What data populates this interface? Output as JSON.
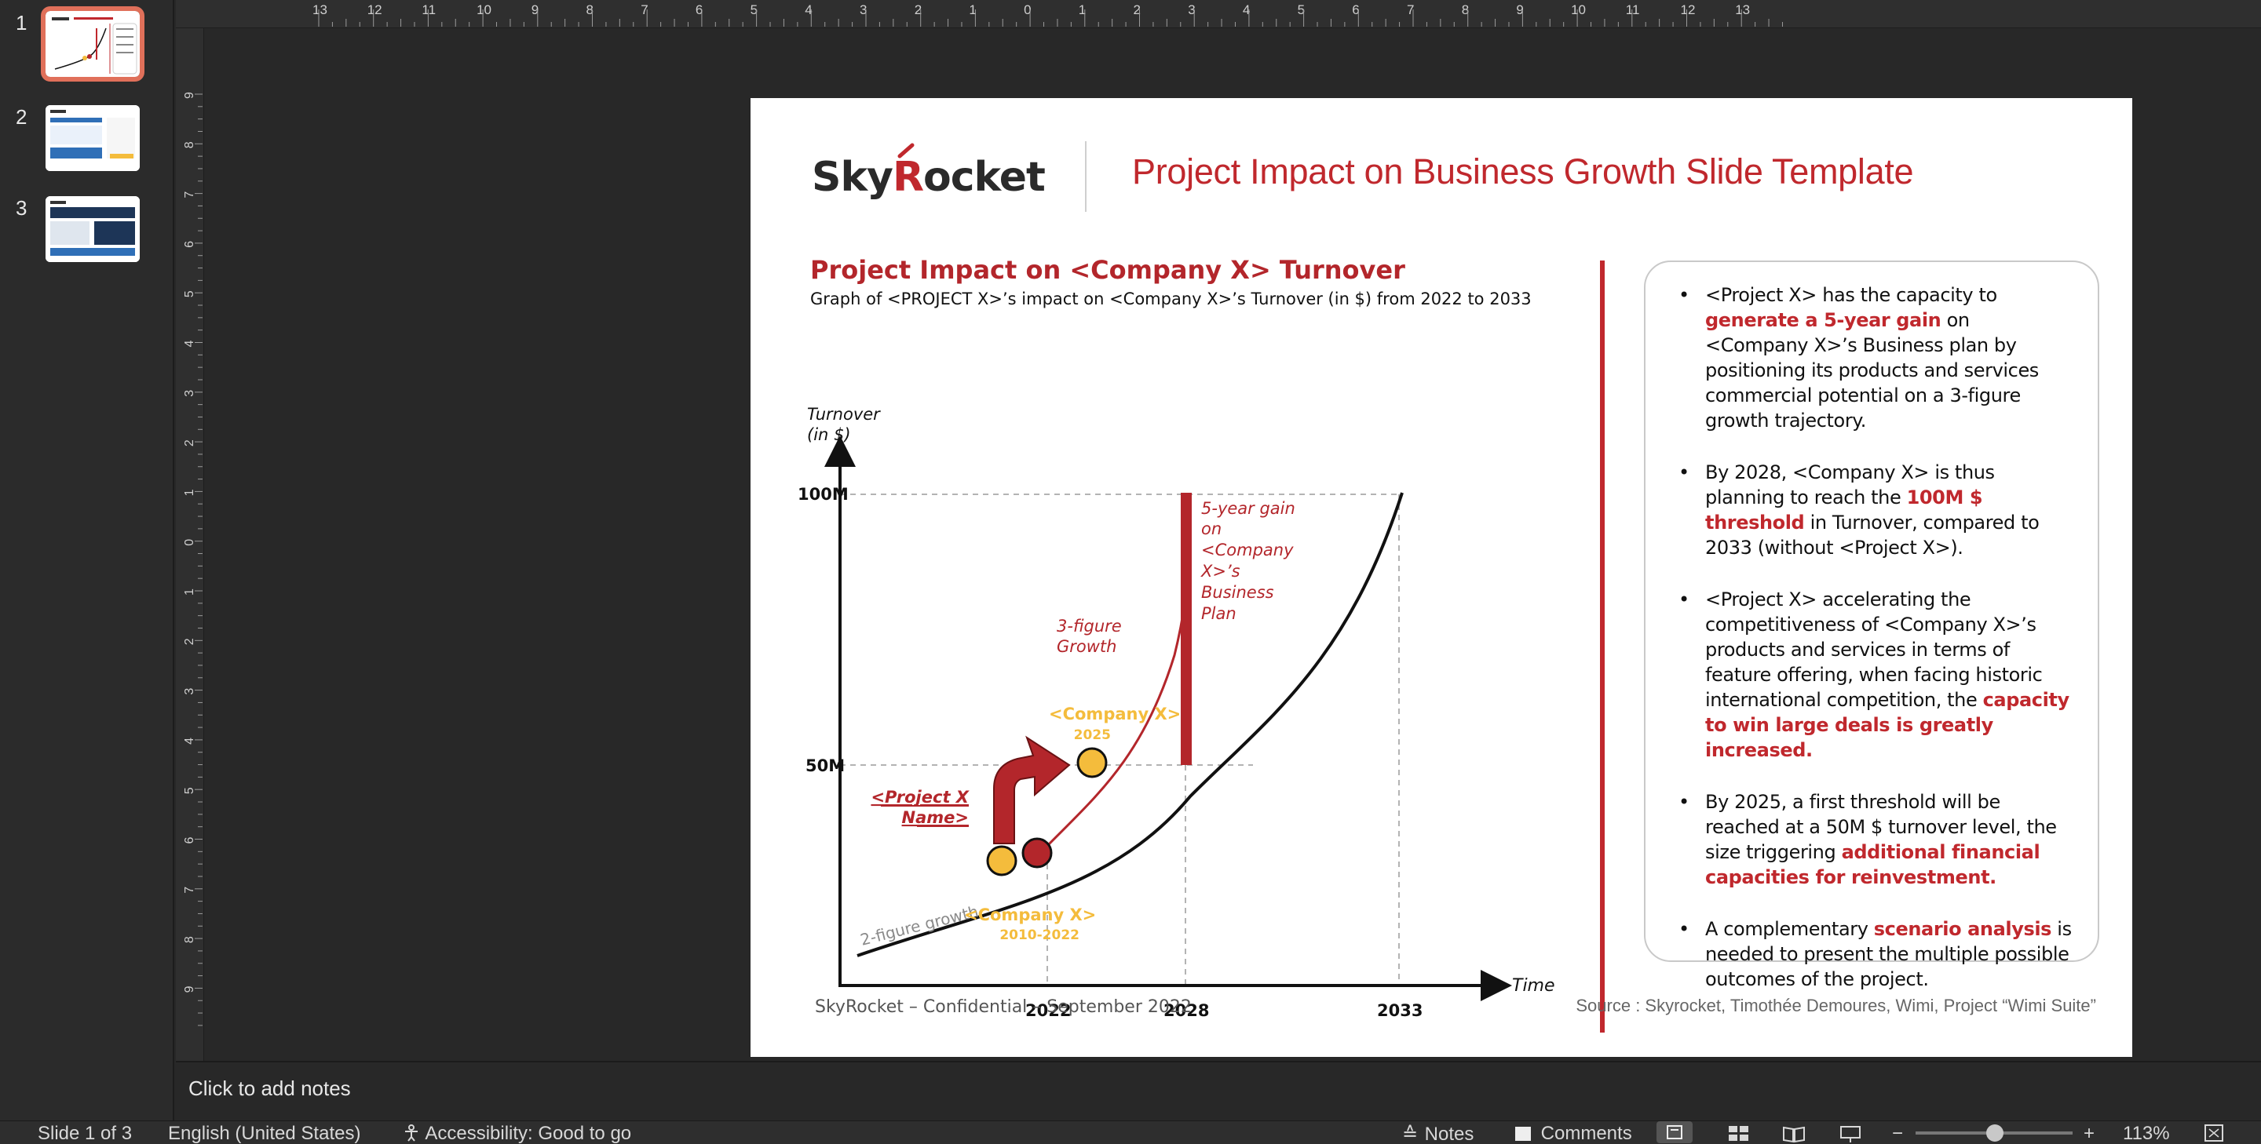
{
  "thumbnails": [
    {
      "number": "1",
      "active": true
    },
    {
      "number": "2",
      "active": false
    },
    {
      "number": "3",
      "active": false
    }
  ],
  "ruler": {
    "top_labels": [
      "13",
      "12",
      "11",
      "10",
      "9",
      "8",
      "7",
      "6",
      "5",
      "4",
      "3",
      "2",
      "1",
      "0",
      "1",
      "2",
      "3",
      "4",
      "5",
      "6",
      "7",
      "8",
      "9",
      "10",
      "11",
      "12",
      "13"
    ],
    "left_labels": [
      "9",
      "8",
      "7",
      "6",
      "5",
      "4",
      "3",
      "2",
      "1",
      "0",
      "1",
      "2",
      "3",
      "4",
      "5",
      "6",
      "7",
      "8",
      "9"
    ]
  },
  "slide": {
    "logo_text": "SkyRocket",
    "title": "Project Impact on Business Growth Slide Template",
    "chart_title": "Project Impact on <Company X> Turnover",
    "chart_subtitle": "Graph of <PROJECT X>’s impact on <Company X>’s Turnover (in $) from 2022 to 2033",
    "footer_left": "SkyRocket – Confidential – September 2022",
    "footer_right": "Source : Skyrocket, Timothée Demoures, Wimi, Project “Wimi Suite”",
    "bullets": [
      {
        "parts": [
          {
            "t": "<Project X> has the capacity to ",
            "hl": false
          },
          {
            "t": "generate a 5-year gain",
            "hl": true
          },
          {
            "t": " on <Company X>’s Business plan by positioning its products and services commercial potential on a 3-figure growth trajectory.",
            "hl": false
          }
        ]
      },
      {
        "parts": [
          {
            "t": "By 2028, <Company X> is thus planning to reach the ",
            "hl": false
          },
          {
            "t": "100M $ threshold",
            "hl": true
          },
          {
            "t": " in Turnover, compared to 2033 (without <Project X>).",
            "hl": false
          }
        ]
      },
      {
        "parts": [
          {
            "t": "<Project X> accelerating the competitiveness of <Company X>’s products and services in terms of feature offering, when facing historic international competition, the ",
            "hl": false
          },
          {
            "t": "capacity to win large deals is greatly increased.",
            "hl": true
          }
        ]
      },
      {
        "parts": [
          {
            "t": "By 2025, a first threshold will be reached at a 50M $ turnover level, the size triggering ",
            "hl": false
          },
          {
            "t": "additional financial capacities for reinvestment.",
            "hl": true
          }
        ]
      },
      {
        "parts": [
          {
            "t": "A complementary ",
            "hl": false
          },
          {
            "t": "scenario analysis",
            "hl": true
          },
          {
            "t": " is needed to present the multiple possible outcomes of the project.",
            "hl": false
          }
        ]
      }
    ]
  },
  "chart_data": {
    "type": "line",
    "title": "Project Impact on <Company X> Turnover",
    "subtitle": "Graph of <PROJECT X>’s impact on <Company X>’s Turnover (in $) from 2022 to 2033",
    "ylabel_lines": [
      "Turnover",
      "(in $)"
    ],
    "xlabel": "Time",
    "y_ticks": [
      "100M",
      "50M"
    ],
    "x_ticks": [
      "2022",
      "2028",
      "2033"
    ],
    "series": [],
    "annotations": {
      "baseline_label": "2-figure growth",
      "growth_label_lines": [
        "3-figure",
        "Growth"
      ],
      "gain_label_lines": [
        "5-year gain",
        "on",
        "<Company",
        "X>’s",
        "Business",
        "Plan"
      ],
      "project_label_lines": [
        "<Project X",
        "Name>"
      ],
      "company_2025_lines": [
        "<Company X>",
        "2025"
      ],
      "company_2010_lines": [
        "<Company X>",
        "2010-2022"
      ]
    },
    "colors": {
      "red": "#b3262b",
      "yellow": "#f4bc3c",
      "black": "#111111",
      "gray": "#9a9a9a"
    }
  },
  "notes": {
    "placeholder": "Click to add notes"
  },
  "status": {
    "slide_info": "Slide 1 of 3",
    "language": "English (United States)",
    "accessibility": "Accessibility: Good to go",
    "notes_label": "Notes",
    "comments_label": "Comments",
    "zoom": "113%",
    "zoom_minus": "−",
    "zoom_plus": "+"
  }
}
